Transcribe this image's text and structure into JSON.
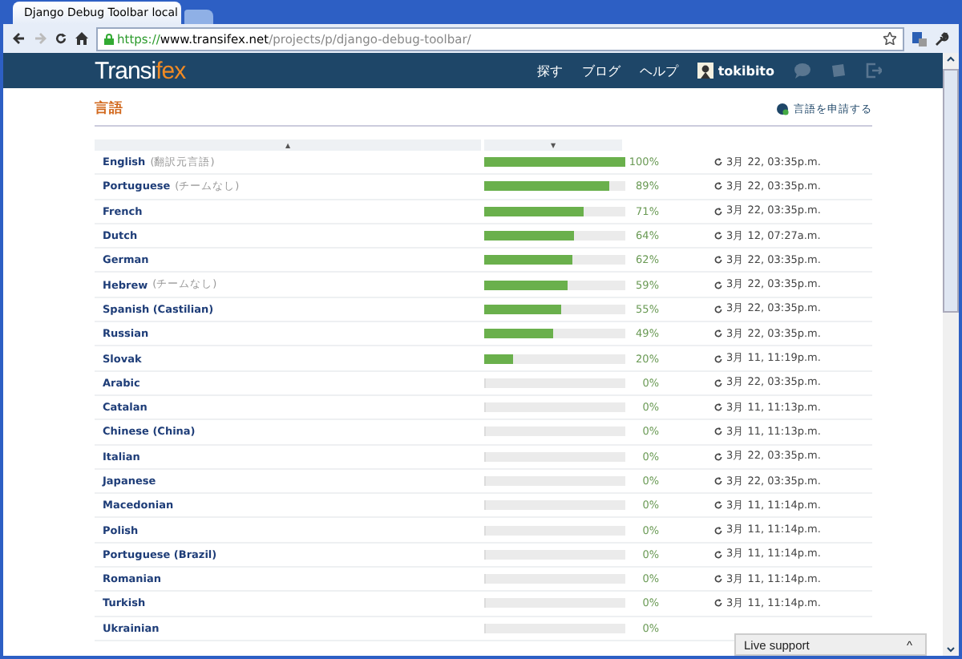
{
  "browser": {
    "tab_title": "Django Debug Toolbar local",
    "url_scheme": "https://",
    "url_host": "www.transifex.net",
    "url_path": "/projects/p/django-debug-toolbar/"
  },
  "nav": {
    "logo_main": "Transi",
    "logo_accent": "fex",
    "links": [
      "探す",
      "ブログ",
      "ヘルプ"
    ],
    "user": "tokibito"
  },
  "section": {
    "title": "言語",
    "request_link": "言語を申請する"
  },
  "columns": [
    "▲",
    "▼"
  ],
  "rows": [
    {
      "name": "English",
      "note": "(翻訳元言語)",
      "level": 1.0,
      "percent": "100%",
      "updated": "3月 22, 03:35p.m."
    },
    {
      "name": "Portuguese",
      "note": "(チームなし)",
      "level": 0.89,
      "percent": "89%",
      "updated": "3月 22, 03:35p.m."
    },
    {
      "name": "French",
      "level": 0.71,
      "percent": "71%",
      "updated": "3月 22, 03:35p.m."
    },
    {
      "name": "Dutch",
      "level": 0.64,
      "percent": "64%",
      "updated": "3月 12, 07:27a.m."
    },
    {
      "name": "German",
      "level": 0.62,
      "percent": "62%",
      "updated": "3月 22, 03:35p.m."
    },
    {
      "name": "Hebrew",
      "note": "(チームなし)",
      "level": 0.59,
      "percent": "59%",
      "updated": "3月 22, 03:35p.m."
    },
    {
      "name": "Spanish (Castilian)",
      "level": 0.55,
      "percent": "55%",
      "updated": "3月 22, 03:35p.m."
    },
    {
      "name": "Russian",
      "level": 0.49,
      "percent": "49%",
      "updated": "3月 22, 03:35p.m."
    },
    {
      "name": "Slovak",
      "level": 0.2,
      "percent": "20%",
      "updated": "3月 11, 11:19p.m."
    },
    {
      "name": "Arabic",
      "level": 0,
      "percent": "0%",
      "updated": "3月 22, 03:35p.m."
    },
    {
      "name": "Catalan",
      "level": 0,
      "percent": "0%",
      "updated": "3月 11, 11:13p.m."
    },
    {
      "name": "Chinese (China)",
      "level": 0,
      "percent": "0%",
      "updated": "3月 11, 11:13p.m."
    },
    {
      "name": "Italian",
      "level": 0,
      "percent": "0%",
      "updated": "3月 22, 03:35p.m."
    },
    {
      "name": "Japanese",
      "level": 0,
      "percent": "0%",
      "updated": "3月 22, 03:35p.m."
    },
    {
      "name": "Macedonian",
      "level": 0,
      "percent": "0%",
      "updated": "3月 11, 11:14p.m."
    },
    {
      "name": "Polish",
      "level": 0,
      "percent": "0%",
      "updated": "3月 11, 11:14p.m."
    },
    {
      "name": "Portuguese (Brazil)",
      "level": 0,
      "percent": "0%",
      "updated": "3月 11, 11:14p.m."
    },
    {
      "name": "Romanian",
      "level": 0,
      "percent": "0%",
      "updated": "3月 11, 11:14p.m."
    },
    {
      "name": "Turkish",
      "level": 0,
      "percent": "0%",
      "updated": "3月 11, 11:14p.m."
    },
    {
      "name": "Ukrainian",
      "level": 0,
      "percent": "0%"
    }
  ],
  "live_support": {
    "label": "Live support",
    "expand": "^"
  }
}
